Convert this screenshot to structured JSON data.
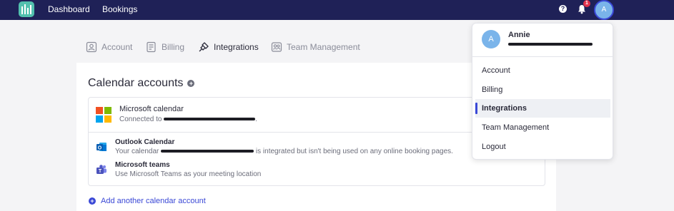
{
  "topbar": {
    "nav": [
      "Dashboard",
      "Bookings"
    ],
    "notification_count": "1",
    "avatar_initial": "A"
  },
  "tabs": [
    {
      "label": "Account",
      "active": false
    },
    {
      "label": "Billing",
      "active": false
    },
    {
      "label": "Integrations",
      "active": true
    },
    {
      "label": "Team Management",
      "active": false
    }
  ],
  "calendar": {
    "title": "Calendar accounts",
    "account_name": "Microsoft calendar",
    "connected_prefix": "Connected to",
    "outlook_title": "Outlook Calendar",
    "outlook_desc_prefix": "Your calendar",
    "outlook_desc_suffix": "is integrated but isn't being used on any online booking pages.",
    "teams_title": "Microsoft teams",
    "teams_desc": "Use Microsoft Teams as your meeting location",
    "add_label": "Add another calendar account"
  },
  "dropdown": {
    "avatar_initial": "A",
    "name": "Annie",
    "items": [
      {
        "label": "Account",
        "active": false
      },
      {
        "label": "Billing",
        "active": false
      },
      {
        "label": "Integrations",
        "active": true
      },
      {
        "label": "Team Management",
        "active": false
      },
      {
        "label": "Logout",
        "active": false
      }
    ]
  },
  "colors": {
    "navbar": "#1f2157",
    "accent": "#3a48d6",
    "logo": "#52c0ae",
    "badge": "#e0314b"
  }
}
